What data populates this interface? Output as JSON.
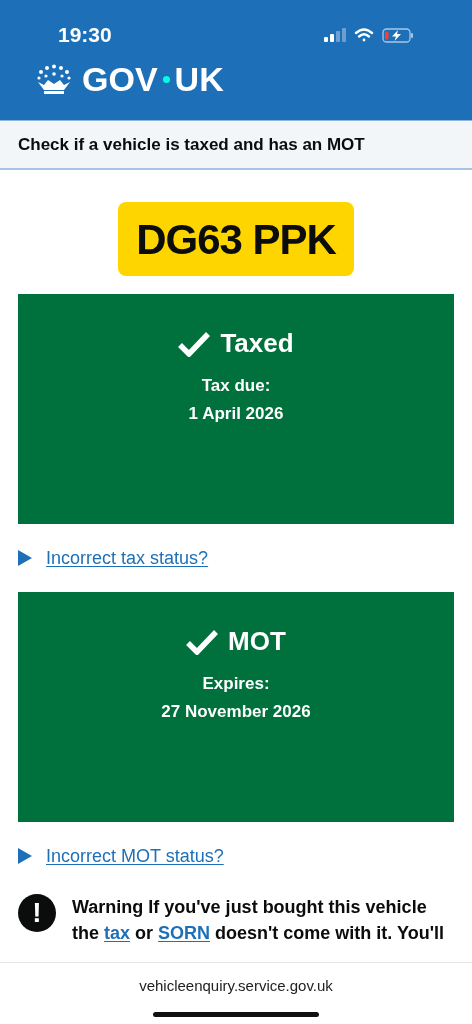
{
  "status_bar": {
    "time": "19:30"
  },
  "header": {
    "logo_left": "GOV",
    "logo_right": "UK"
  },
  "service_name": "Check if a vehicle is taxed and has an MOT",
  "plate": "DG63 PPK",
  "panels": [
    {
      "title": "Taxed",
      "label": "Tax due:",
      "date": "1 April 2026",
      "link": "Incorrect tax status?"
    },
    {
      "title": "MOT",
      "label": "Expires:",
      "date": "27 November 2026",
      "link": "Incorrect MOT status?"
    }
  ],
  "warning": {
    "icon": "!",
    "segments": [
      {
        "text": "Warning If you've just bought this vehicle the ",
        "link": false
      },
      {
        "text": "tax",
        "link": true
      },
      {
        "text": " or ",
        "link": false
      },
      {
        "text": "SORN",
        "link": true
      },
      {
        "text": " doesn't come with it. You'll",
        "link": false
      }
    ]
  },
  "address_bar": {
    "url": "vehicleenquiry.service.gov.uk"
  }
}
